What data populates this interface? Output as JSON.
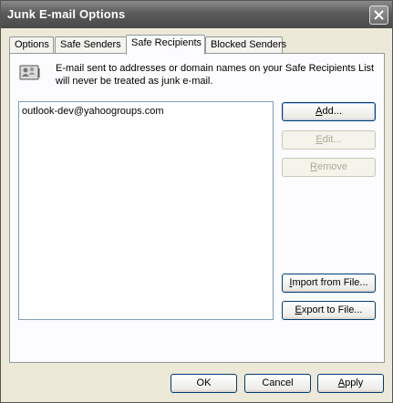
{
  "window": {
    "title": "Junk E-mail Options"
  },
  "tabs": [
    {
      "label": "Options"
    },
    {
      "label": "Safe Senders"
    },
    {
      "label": "Safe Recipients",
      "active": true
    },
    {
      "label": "Blocked Senders"
    }
  ],
  "panel": {
    "info_icon": "address-book-icon",
    "description": "E-mail sent to addresses or domain names on your Safe Recipients List will never be treated as junk e-mail.",
    "list_items": [
      "outlook-dev@yahoogroups.com"
    ],
    "buttons": {
      "add": {
        "mnemonic": "A",
        "rest": "dd..."
      },
      "edit": {
        "mnemonic": "E",
        "rest": "dit..."
      },
      "remove": {
        "mnemonic": "R",
        "rest": "emove"
      },
      "import": {
        "pre": "",
        "mnemonic": "I",
        "rest": "mport from File..."
      },
      "export": {
        "pre": "",
        "mnemonic": "E",
        "rest": "xport to File..."
      }
    }
  },
  "footer": {
    "ok": "OK",
    "cancel": "Cancel",
    "apply": {
      "mnemonic": "A",
      "rest": "pply"
    }
  },
  "colors": {
    "titlebar": "#5a5a5a",
    "dialog_bg": "#ece9d8",
    "button_border": "#003c74"
  }
}
